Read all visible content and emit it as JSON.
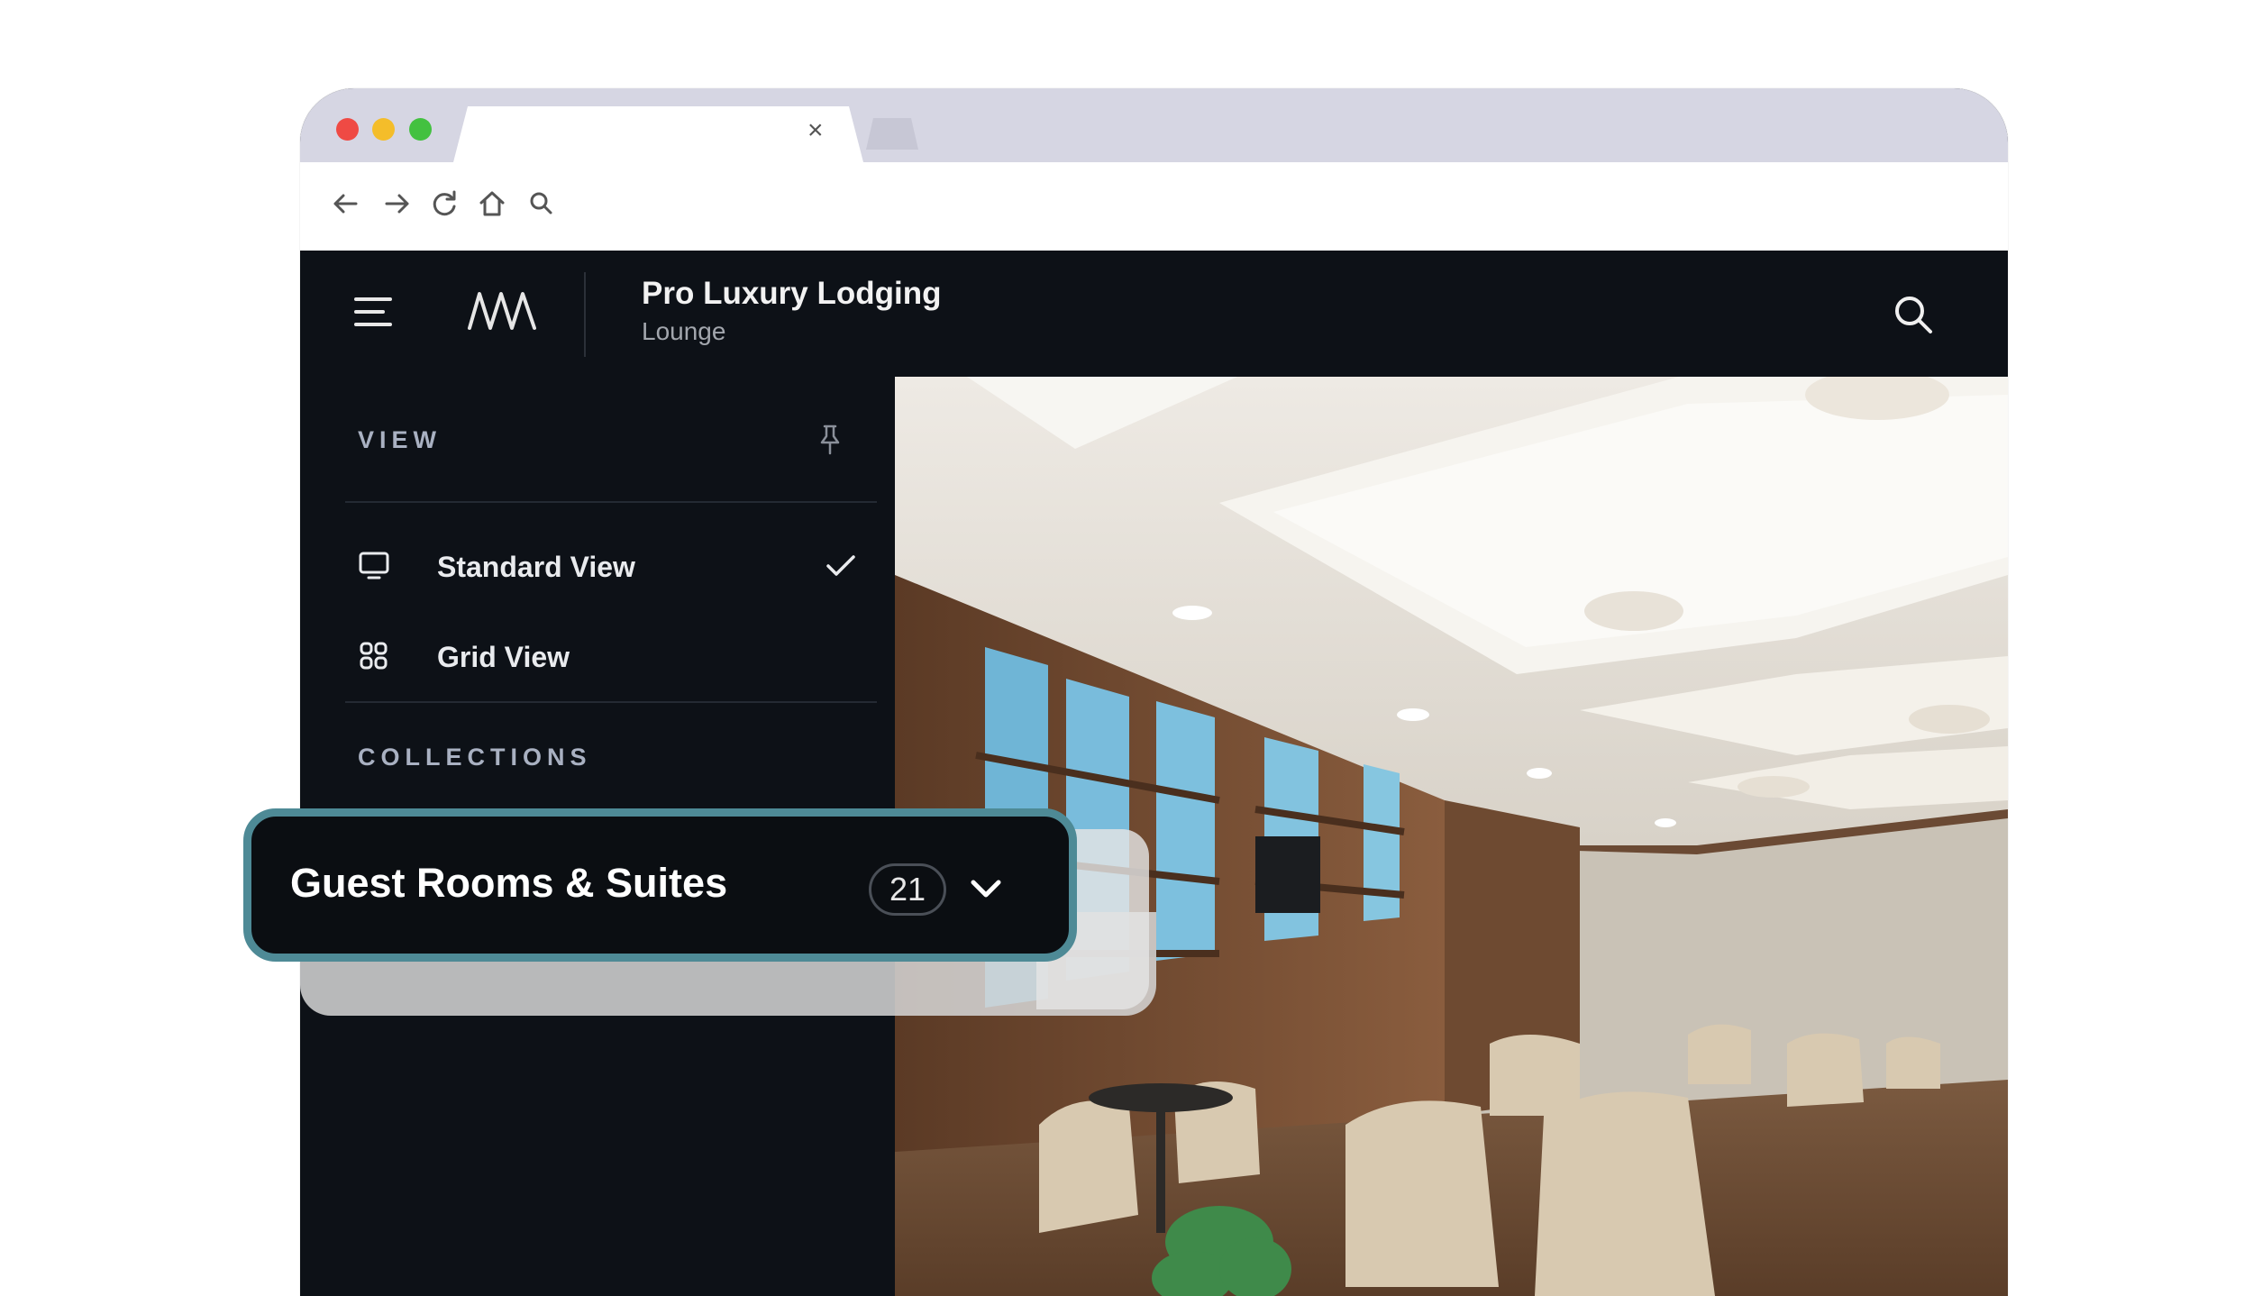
{
  "browser": {
    "tab_close_glyph": "×",
    "nav_icons": [
      "back-arrow-icon",
      "forward-arrow-icon",
      "reload-icon",
      "home-icon",
      "search-icon"
    ]
  },
  "app": {
    "title": "Pro Luxury Lodging",
    "subtitle": "Lounge",
    "menu_icon": "hamburger-menu-icon",
    "logo_icon": "brand-logo-icon",
    "search_icon": "search-icon"
  },
  "sidebar": {
    "view_heading": "VIEW",
    "pin_icon": "pin-icon",
    "view_options": [
      {
        "label": "Standard View",
        "icon": "monitor-icon",
        "selected": true
      },
      {
        "label": "Grid View",
        "icon": "grid-icon",
        "selected": false
      }
    ],
    "collections_heading": "COLLECTIONS"
  },
  "collection": {
    "label": "Guest Rooms & Suites",
    "count": "21",
    "toggle_icon": "chevron-down-icon"
  },
  "colors": {
    "app_background": "#0d1117",
    "highlight_border": "#4e8a96",
    "tab_bar": "#d6d6e3",
    "traffic_red": "#ef4a44",
    "traffic_yellow": "#f4bd2a",
    "traffic_green": "#43c140"
  }
}
